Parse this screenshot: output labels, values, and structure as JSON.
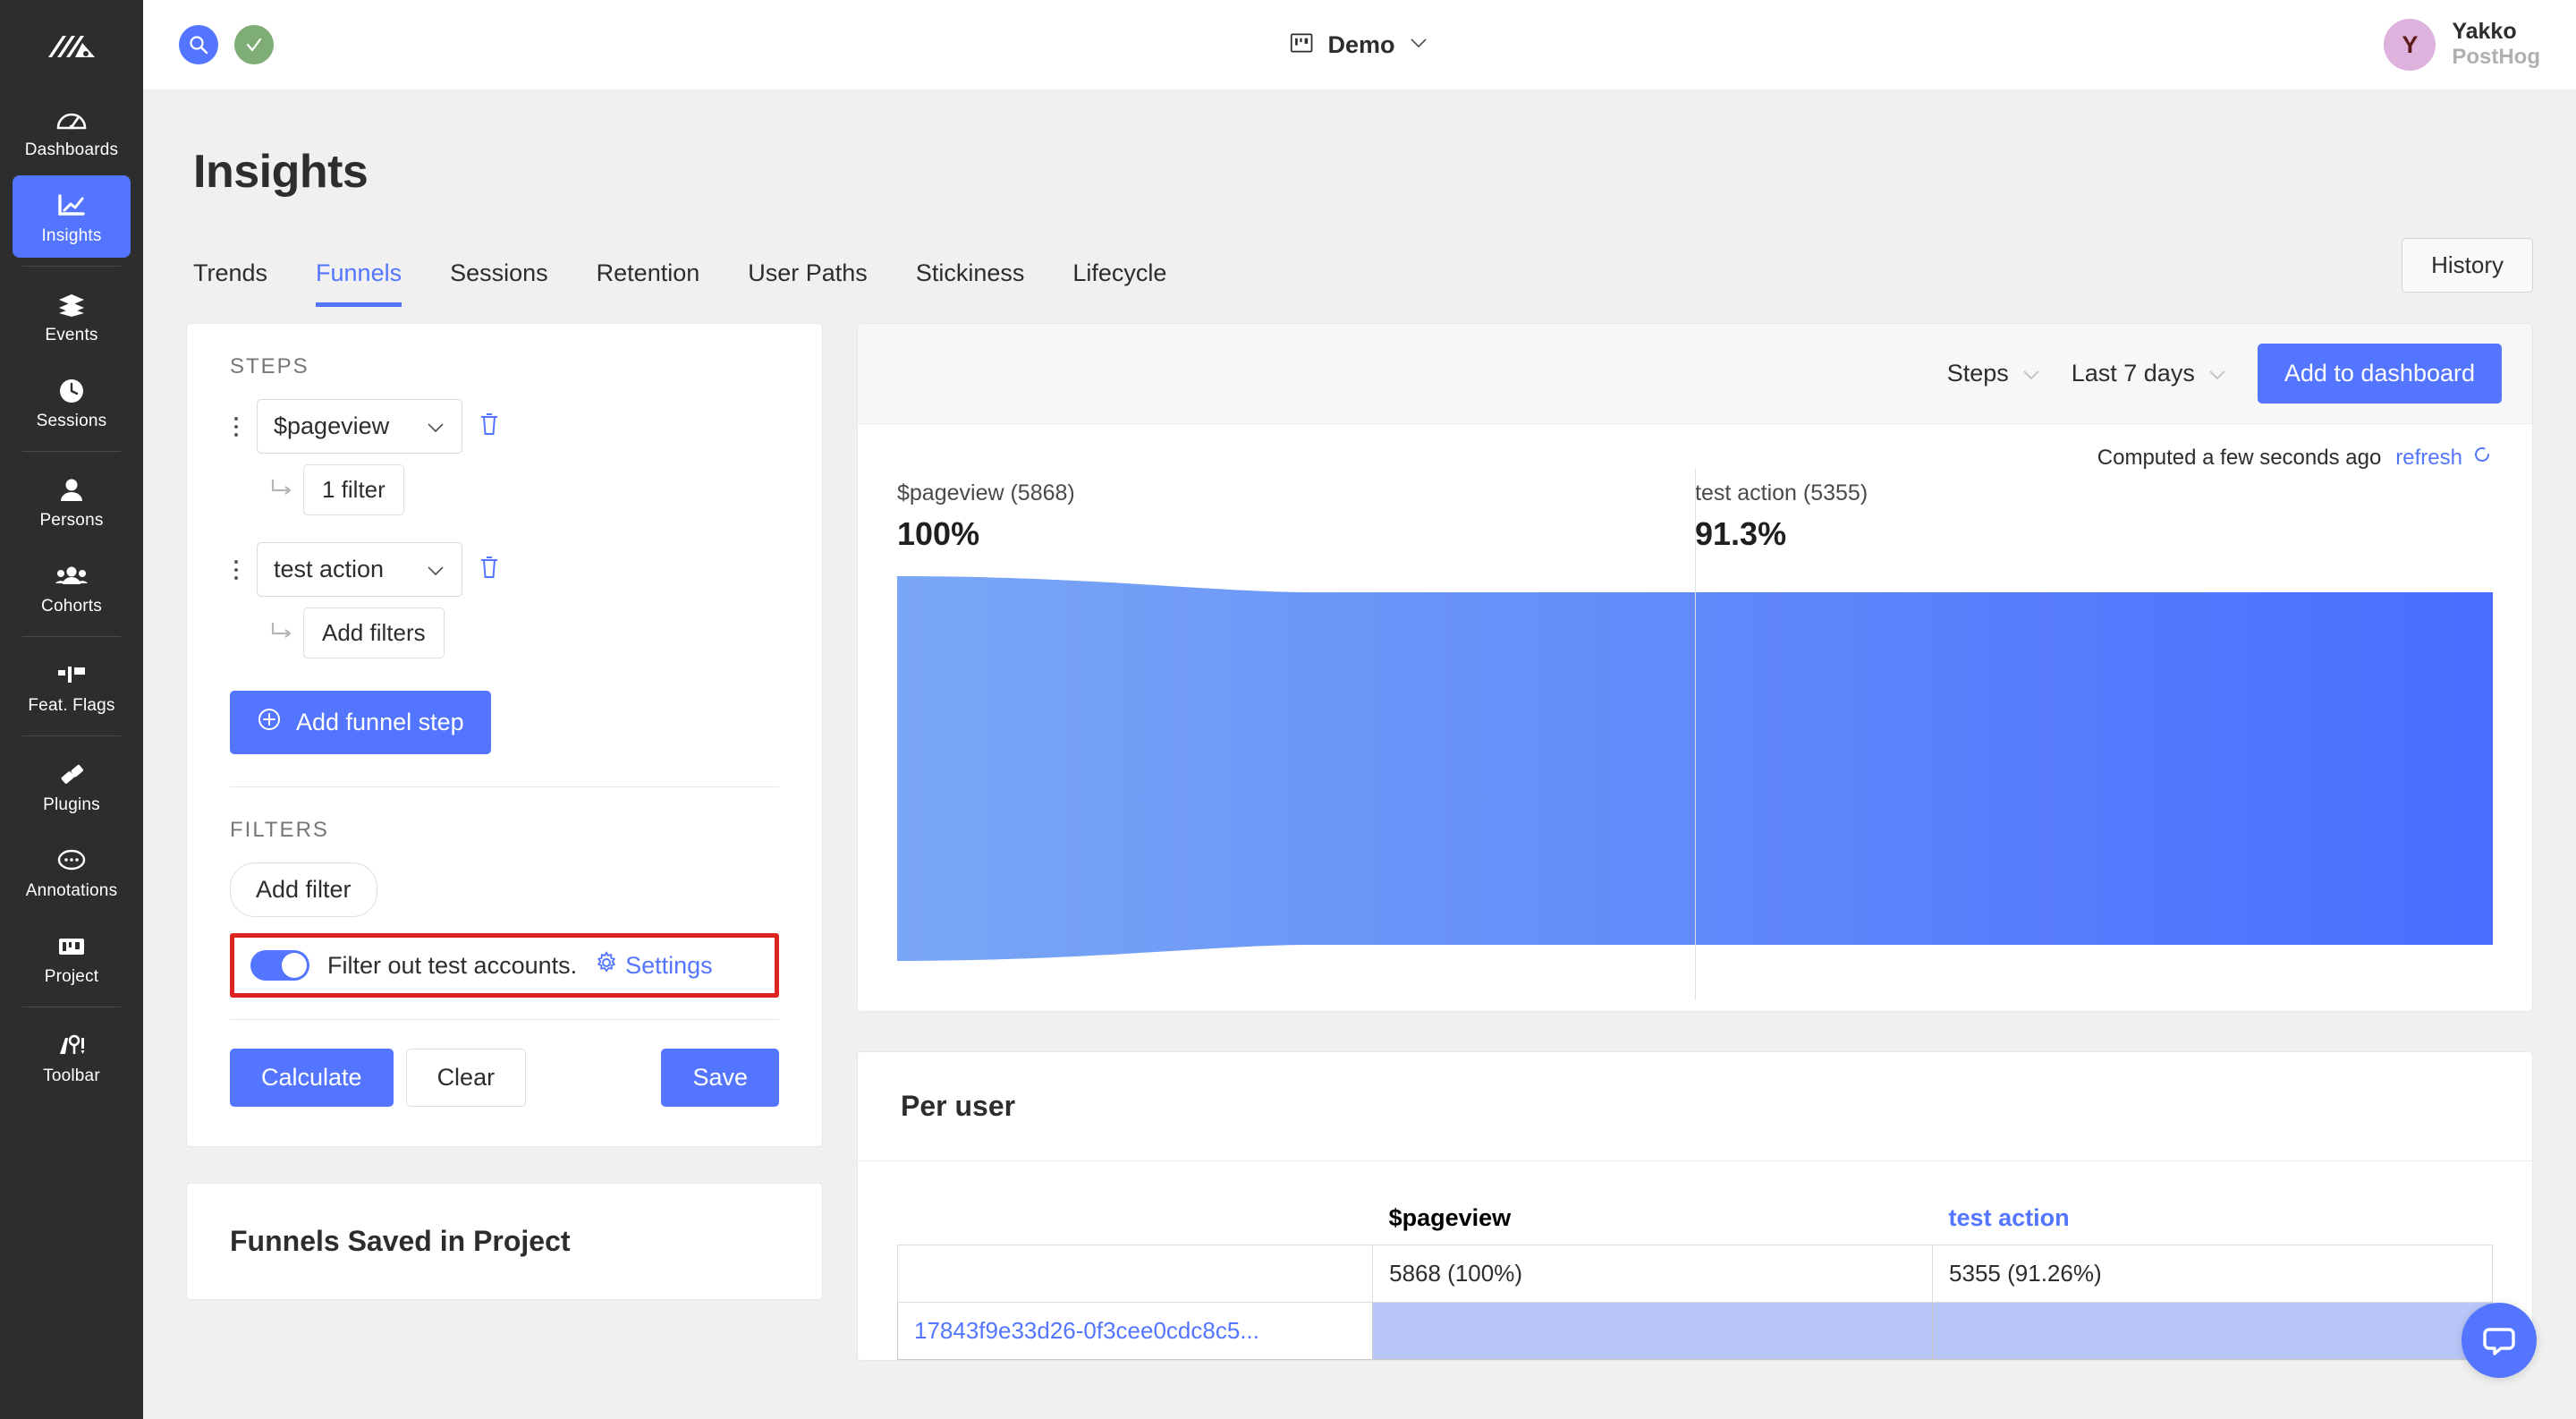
{
  "nav": {
    "logo_icon": "posthog-logo-icon",
    "items": [
      {
        "label": "Dashboards",
        "icon": "dashboard-icon",
        "active": false
      },
      {
        "label": "Insights",
        "icon": "insights-chart-icon",
        "active": true
      },
      {
        "label": "Events",
        "icon": "events-layers-icon",
        "active": false
      },
      {
        "label": "Sessions",
        "icon": "clock-icon",
        "active": false
      },
      {
        "label": "Persons",
        "icon": "person-icon",
        "active": false
      },
      {
        "label": "Cohorts",
        "icon": "people-group-icon",
        "active": false
      },
      {
        "label": "Feat. Flags",
        "icon": "flag-icon",
        "active": false
      },
      {
        "label": "Plugins",
        "icon": "plug-icon",
        "active": false
      },
      {
        "label": "Annotations",
        "icon": "comment-icon",
        "active": false
      },
      {
        "label": "Project",
        "icon": "project-board-icon",
        "active": false
      },
      {
        "label": "Toolbar",
        "icon": "toolbar-icon",
        "active": false
      }
    ]
  },
  "topbar": {
    "search_icon": "search-icon",
    "status_icon": "check-circle-icon",
    "project_icon": "project-board-icon",
    "project_name": "Demo",
    "project_chevron": "chevron-down-icon",
    "avatar_initial": "Y",
    "user_name": "Yakko",
    "user_org": "PostHog"
  },
  "page": {
    "title": "Insights",
    "history_label": "History",
    "tabs": [
      {
        "label": "Trends",
        "active": false
      },
      {
        "label": "Funnels",
        "active": true
      },
      {
        "label": "Sessions",
        "active": false
      },
      {
        "label": "Retention",
        "active": false
      },
      {
        "label": "User Paths",
        "active": false
      },
      {
        "label": "Stickiness",
        "active": false
      },
      {
        "label": "Lifecycle",
        "active": false
      }
    ]
  },
  "steps_panel": {
    "section_label": "STEPS",
    "steps": [
      {
        "name": "$pageview",
        "chevron": "chevron-down-icon",
        "delete_icon": "trash-icon",
        "filter_label": "1 filter"
      },
      {
        "name": "test action",
        "chevron": "chevron-down-icon",
        "delete_icon": "trash-icon",
        "filter_label": "Add filters"
      }
    ],
    "add_step_label": "Add funnel step",
    "add_step_icon": "plus-circle-icon",
    "filters_label": "FILTERS",
    "add_filter_label": "Add filter",
    "test_accounts_toggle_on": true,
    "test_accounts_label": "Filter out test accounts.",
    "settings_icon": "gear-icon",
    "settings_label": "Settings",
    "calculate_label": "Calculate",
    "clear_label": "Clear",
    "save_label": "Save"
  },
  "saved_panel": {
    "title": "Funnels Saved in Project"
  },
  "chart_panel": {
    "display_mode": "Steps",
    "date_range": "Last 7 days",
    "add_to_dashboard_label": "Add to dashboard",
    "computed_text": "Computed a few seconds ago",
    "refresh_label": "refresh",
    "refresh_icon": "refresh-icon"
  },
  "per_user": {
    "title": "Per user",
    "columns": [
      "",
      "$pageview",
      "test action"
    ],
    "summary_row": [
      "",
      "5868  (100%)",
      "5355  (91.26%)"
    ],
    "rows": [
      {
        "person": "17843f9e33d26-0f3cee0cdc8c5...",
        "bars": [
          100,
          100
        ]
      }
    ]
  },
  "chat": {
    "icon": "chat-bubble-icon"
  },
  "colors": {
    "accent": "#5375ff",
    "nav_bg": "#2d2d2d",
    "highlight_border": "#dd2222",
    "funnel_start": "#7aa7f5",
    "funnel_end": "#4a6cff",
    "bar_fill": "#b9c6f7",
    "avatar_bg": "#ddb3dd",
    "status_green": "#7eae75"
  },
  "chart_data": {
    "type": "bar",
    "title": "Funnel conversion",
    "subtype": "funnel",
    "categories": [
      "$pageview",
      "test action"
    ],
    "values": [
      5868,
      5355
    ],
    "percentages": [
      100,
      91.3
    ],
    "labels": [
      "$pageview (5868)",
      "test action (5355)"
    ],
    "value_labels": [
      "100%",
      "91.3%"
    ],
    "xlabel": "",
    "ylabel": "",
    "ylim": [
      0,
      100
    ],
    "grid": false,
    "legend": "none"
  }
}
